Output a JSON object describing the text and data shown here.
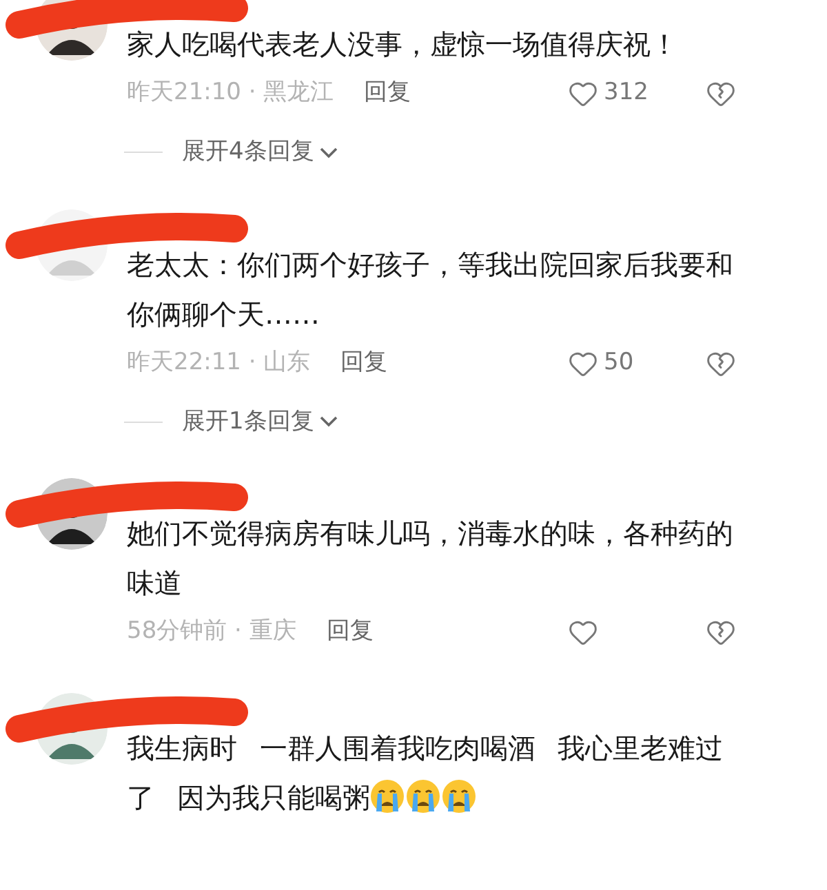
{
  "comments": [
    {
      "text": "家人吃喝代表老人没事，虚惊一场值得庆祝！",
      "meta": "昨天21:10 · 黑龙江",
      "reply_label": "回复",
      "likes": "312",
      "expand": "展开4条回复"
    },
    {
      "text": "老太太：你们两个好孩子，等我出院回家后我要和你俩聊个天……",
      "meta": "昨天22:11 · 山东",
      "reply_label": "回复",
      "likes": "50",
      "expand": "展开1条回复"
    },
    {
      "text": "她们不觉得病房有味儿吗，消毒水的味，各种药的味道",
      "meta": "58分钟前 · 重庆",
      "reply_label": "回复"
    },
    {
      "text": "我生病时 一群人围着我吃肉喝酒 我心里老难过了 因为我只能喝粥",
      "emojis": [
        {
          "kind": "crying"
        },
        {
          "kind": "crying"
        },
        {
          "kind": "crying"
        }
      ]
    }
  ]
}
